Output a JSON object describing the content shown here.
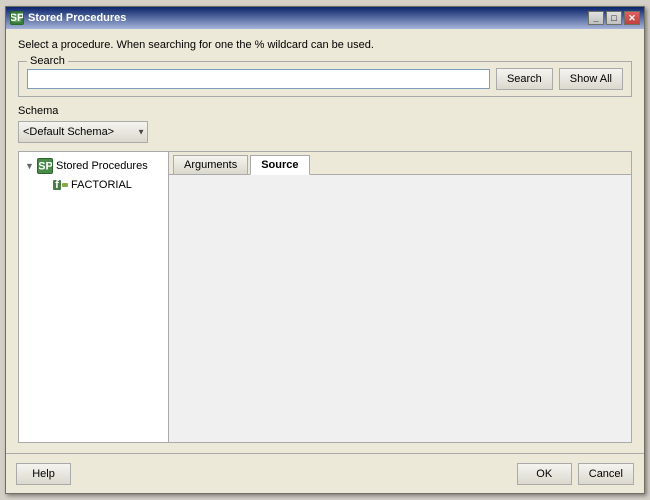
{
  "window": {
    "title": "Stored Procedures",
    "icon": "SP"
  },
  "instruction": "Select a procedure. When searching for one the % wildcard can be used.",
  "search": {
    "group_label": "Search",
    "placeholder": "",
    "search_button": "Search",
    "show_all_button": "Show All"
  },
  "schema": {
    "label": "Schema",
    "default_option": "<Default Schema>",
    "options": [
      "<Default Schema>"
    ]
  },
  "tree": {
    "root_label": "Stored Procedures",
    "child_label": "FACTORIAL"
  },
  "tabs": [
    {
      "id": "arguments",
      "label": "Arguments",
      "active": false
    },
    {
      "id": "source",
      "label": "Source",
      "active": true
    }
  ],
  "footer": {
    "help_button": "Help",
    "ok_button": "OK",
    "cancel_button": "Cancel"
  },
  "titlebar_buttons": {
    "minimize": "_",
    "maximize": "□",
    "close": "✕"
  }
}
